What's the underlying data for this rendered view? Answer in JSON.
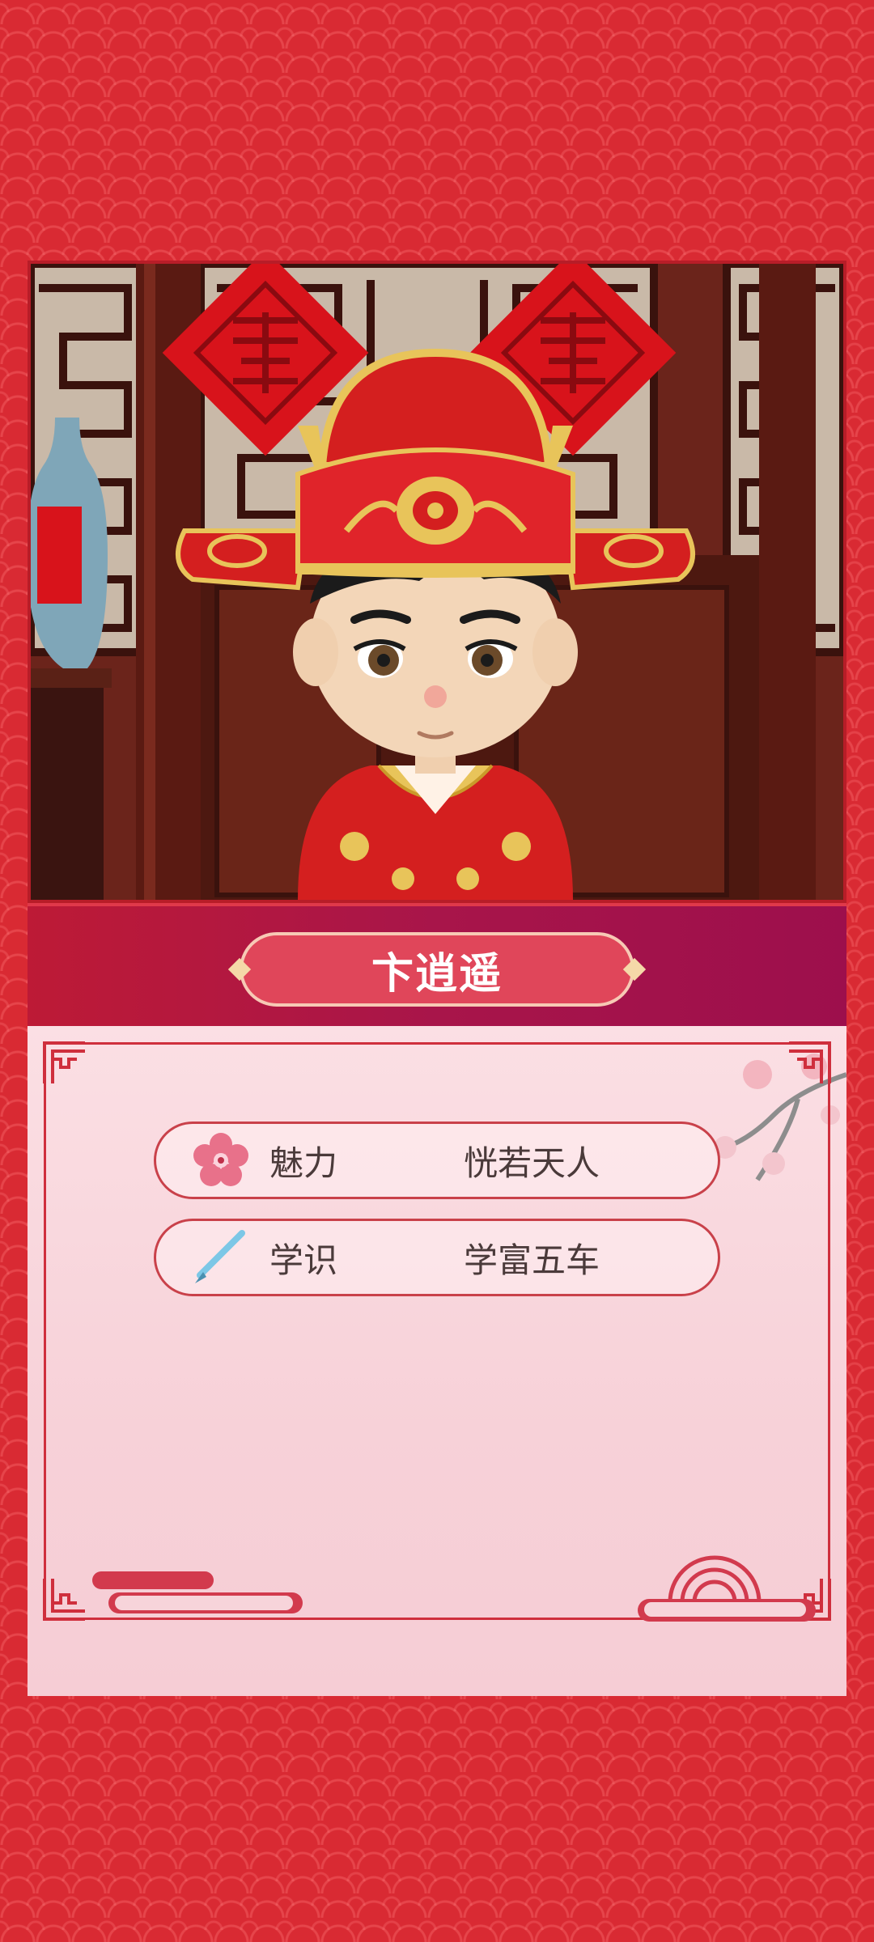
{
  "character": {
    "name": "卞逍遥"
  },
  "stats": [
    {
      "icon": "plum-blossom-icon",
      "label": "魅力",
      "value": "恍若天人"
    },
    {
      "icon": "brush-pen-icon",
      "label": "学识",
      "value": "学富五车"
    }
  ],
  "colors": {
    "background": "#d92a33",
    "name_band": "#a8154a",
    "name_plate": "#e0465a",
    "panel": "#f9d8de",
    "frame": "#cf2f3d"
  }
}
